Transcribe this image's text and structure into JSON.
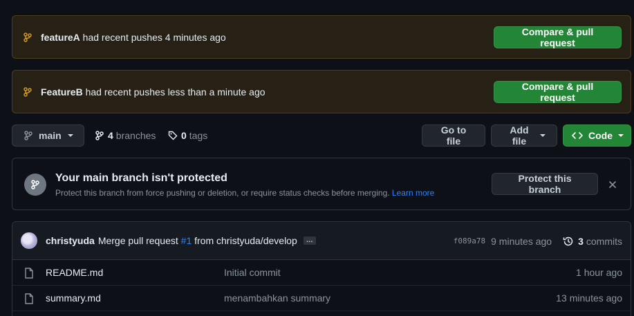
{
  "banners": [
    {
      "branch": "featureA",
      "message": " had recent pushes 4 minutes ago",
      "button": "Compare & pull request"
    },
    {
      "branch": "FeatureB",
      "message": " had recent pushes less than a minute ago",
      "button": "Compare & pull request"
    }
  ],
  "toolbar": {
    "branch_selector": "main",
    "branches_count": "4",
    "branches_label": "branches",
    "tags_count": "0",
    "tags_label": "tags",
    "go_to_file": "Go to file",
    "add_file": "Add file",
    "code": "Code"
  },
  "protect": {
    "title": "Your main branch isn't protected",
    "description": "Protect this branch from force pushing or deletion, or require status checks before merging. ",
    "learn_more": "Learn more",
    "button": "Protect this branch"
  },
  "commit": {
    "author": "christyuda",
    "message_prefix": "Merge pull request ",
    "pr_link": "#1",
    "message_suffix": " from christyuda/develop",
    "ellipsis": "…",
    "sha": "f089a78",
    "time": "9 minutes ago",
    "commits_count": "3",
    "commits_label": "commits"
  },
  "files": [
    {
      "name": "README.md",
      "message": "Initial commit",
      "age": "1 hour ago"
    },
    {
      "name": "summary.md",
      "message": "menambahkan summary",
      "age": "13 minutes ago"
    }
  ],
  "colors": {
    "background": "#0d1117",
    "banner_bg": "#272115",
    "banner_border": "#4c3d1c",
    "green_button": "#238636",
    "link_blue": "#2f81f7",
    "branch_icon_yellow": "#d29922"
  }
}
